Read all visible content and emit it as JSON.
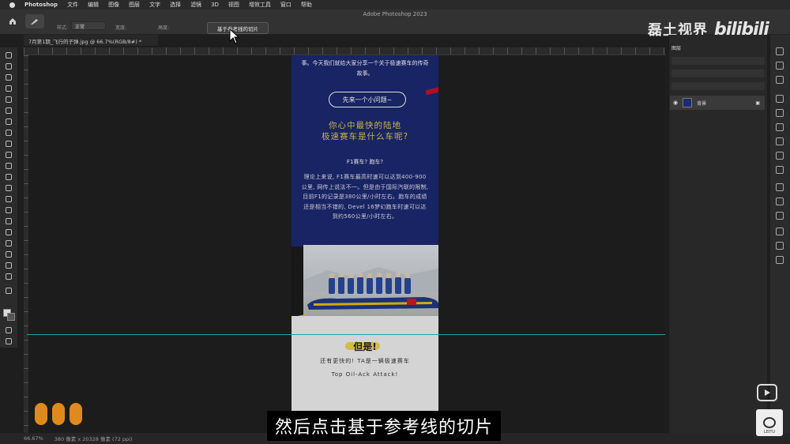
{
  "menubar": {
    "app_name": "Photoshop",
    "items": [
      "文件",
      "编辑",
      "图像",
      "图层",
      "文字",
      "选择",
      "滤镜",
      "3D",
      "视图",
      "增效工具",
      "窗口",
      "帮助"
    ]
  },
  "window": {
    "title": "Adobe Photoshop 2023"
  },
  "options_bar": {
    "style_label": "样式:",
    "style_value": "正常",
    "width_label": "宽度:",
    "height_label": "高度:",
    "slice_from_guides_button": "基于参考线的切片"
  },
  "document": {
    "tab_title": "7月第1期_飞行的子弹.jpg @ 66.7%(RGB/8#) *",
    "intro_text": "事。今天我们就给大家分享一个关于极速赛车的传奇故事。",
    "question_pill": "先来一个小问题~",
    "question_line1": "你心中最快的陆地",
    "question_line2": "极速赛车是什么车呢?",
    "f1_question": "F1赛车? 跑车?",
    "body_text": "理论上来说, F1赛车最高时速可以达到400-900公里, 网传上说法不一。但是由于国际汽联的限制, 目前F1的记录是380公里/小时左右。跑车的成绩还是相当不错的, Devel 16梦幻跑车时速可以达到约560公里/小时左右。",
    "but_text": "但是!",
    "faster_text": "还有更快的! TA是一辆极速赛车",
    "car_name": "Top Oil-Ack Attack!"
  },
  "layers_panel": {
    "tab_label": "图层",
    "layer_name": "背景"
  },
  "status_bar": {
    "zoom": "66.67%",
    "doc_info": "380 像素 x 20328 像素 (72 ppi)"
  },
  "watermark": {
    "channel_name": "磊土视界",
    "bili_logo": "bilibili"
  },
  "subtitle": "然后点击基于参考线的切片",
  "leitu_logo_text": "LEITU",
  "colors": {
    "doc_blue": "#1c2a72",
    "headline_yellow": "#e3cc4a",
    "guide_cyan": "#1fa3a3",
    "orange_logo": "#e08a1e"
  }
}
